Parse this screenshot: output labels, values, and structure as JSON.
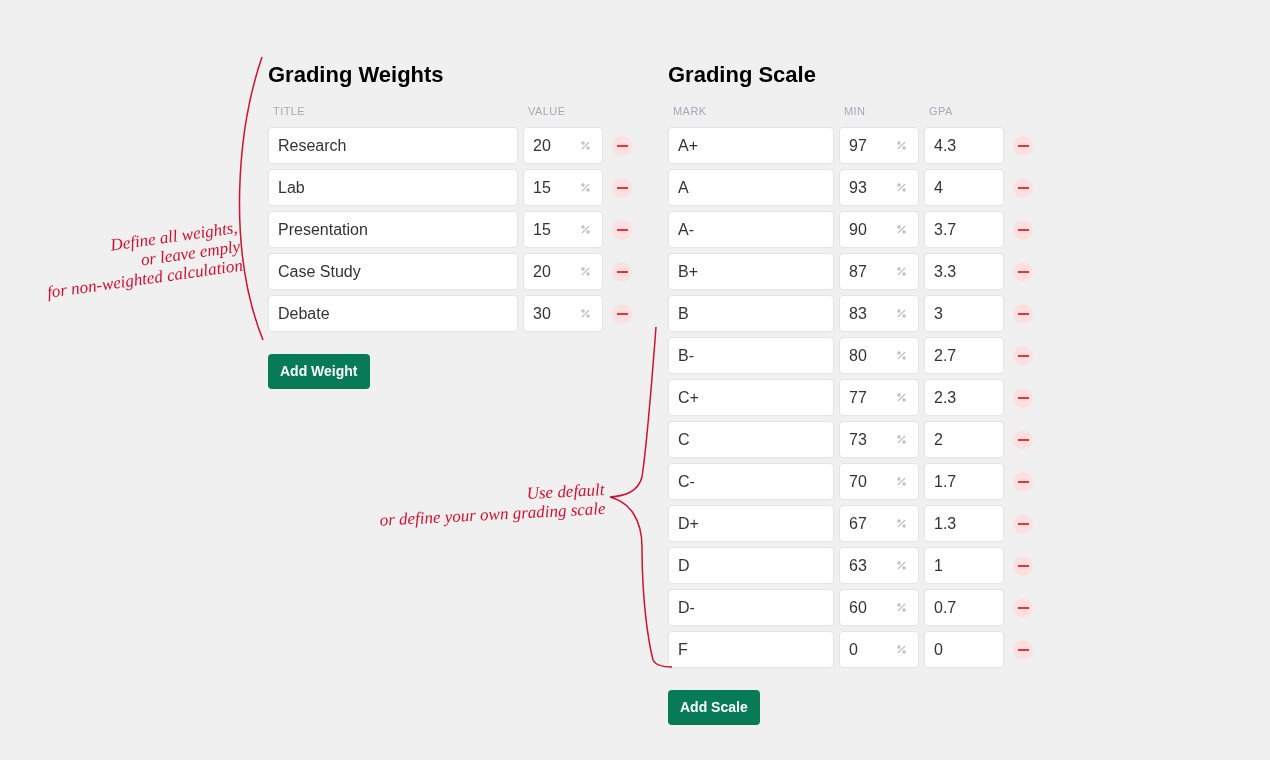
{
  "weights": {
    "title": "Grading Weights",
    "columns": [
      "TITLE",
      "VALUE"
    ],
    "rows": [
      {
        "title": "Research",
        "value": "20"
      },
      {
        "title": "Lab",
        "value": "15"
      },
      {
        "title": "Presentation",
        "value": "15"
      },
      {
        "title": "Case Study",
        "value": "20"
      },
      {
        "title": "Debate",
        "value": "30"
      }
    ],
    "add_button": "Add Weight"
  },
  "scale": {
    "title": "Grading Scale",
    "columns": [
      "MARK",
      "MIN",
      "GPA"
    ],
    "rows": [
      {
        "mark": "A+",
        "min": "97",
        "gpa": "4.3"
      },
      {
        "mark": "A",
        "min": "93",
        "gpa": "4"
      },
      {
        "mark": "A-",
        "min": "90",
        "gpa": "3.7"
      },
      {
        "mark": "B+",
        "min": "87",
        "gpa": "3.3"
      },
      {
        "mark": "B",
        "min": "83",
        "gpa": "3"
      },
      {
        "mark": "B-",
        "min": "80",
        "gpa": "2.7"
      },
      {
        "mark": "C+",
        "min": "77",
        "gpa": "2.3"
      },
      {
        "mark": "C",
        "min": "73",
        "gpa": "2"
      },
      {
        "mark": "C-",
        "min": "70",
        "gpa": "1.7"
      },
      {
        "mark": "D+",
        "min": "67",
        "gpa": "1.3"
      },
      {
        "mark": "D",
        "min": "63",
        "gpa": "1"
      },
      {
        "mark": "D-",
        "min": "60",
        "gpa": "0.7"
      },
      {
        "mark": "F",
        "min": "0",
        "gpa": "0"
      }
    ],
    "add_button": "Add Scale"
  },
  "annotations": [
    {
      "lines": [
        "Define all weights,",
        "or leave emply",
        "for non-weighted calculation"
      ]
    },
    {
      "lines": [
        "Use default",
        "or define your own grading scale"
      ]
    }
  ]
}
